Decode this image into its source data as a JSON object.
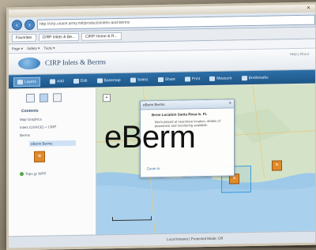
{
  "browser": {
    "url": "http://cirp.usace.army.mil/products/inlets-and-berms",
    "tabs": [
      "Favorites",
      "CIRP Inlets & Be...",
      "CIRP Home & R..."
    ],
    "command_bar": [
      "Page ▾",
      "Safety ▾",
      "Tools ▾"
    ]
  },
  "app": {
    "title": "CIRP Inlets & Berms",
    "header_right": "Help  |  About"
  },
  "toolbar": {
    "items": [
      {
        "label": "Layers",
        "icon": "layers-icon"
      },
      {
        "label": "Add",
        "icon": "add-icon"
      },
      {
        "label": "Edit",
        "icon": "edit-icon"
      },
      {
        "label": "Basemap",
        "icon": "basemap-icon"
      },
      {
        "label": "Select",
        "icon": "select-icon"
      },
      {
        "label": "Share",
        "icon": "share-icon"
      },
      {
        "label": "Print",
        "icon": "print-icon"
      },
      {
        "label": "Measure",
        "icon": "measure-icon"
      },
      {
        "label": "Bookmarks",
        "icon": "bookmark-icon"
      }
    ]
  },
  "sidebar": {
    "contents_label": "Contents",
    "layers": [
      "Map Graphics",
      "Inlets (USACE) + CIRP",
      "Berms"
    ],
    "selected_layer": "eBerm Berms",
    "extra_layer": "Topo gr WPP"
  },
  "popup": {
    "header": "eBerm Berms",
    "subtitle": "Berm Location   Santa Rosa Is. FL",
    "body": "Berm placed at nearshore location, details of placement and monitoring available.",
    "link": "Zoom to"
  },
  "overlay_text": "eBerm",
  "statusbar": "Local intranet | Protected Mode: Off",
  "colors": {
    "toolbar": "#1d5687",
    "accent": "#e08a2a"
  }
}
